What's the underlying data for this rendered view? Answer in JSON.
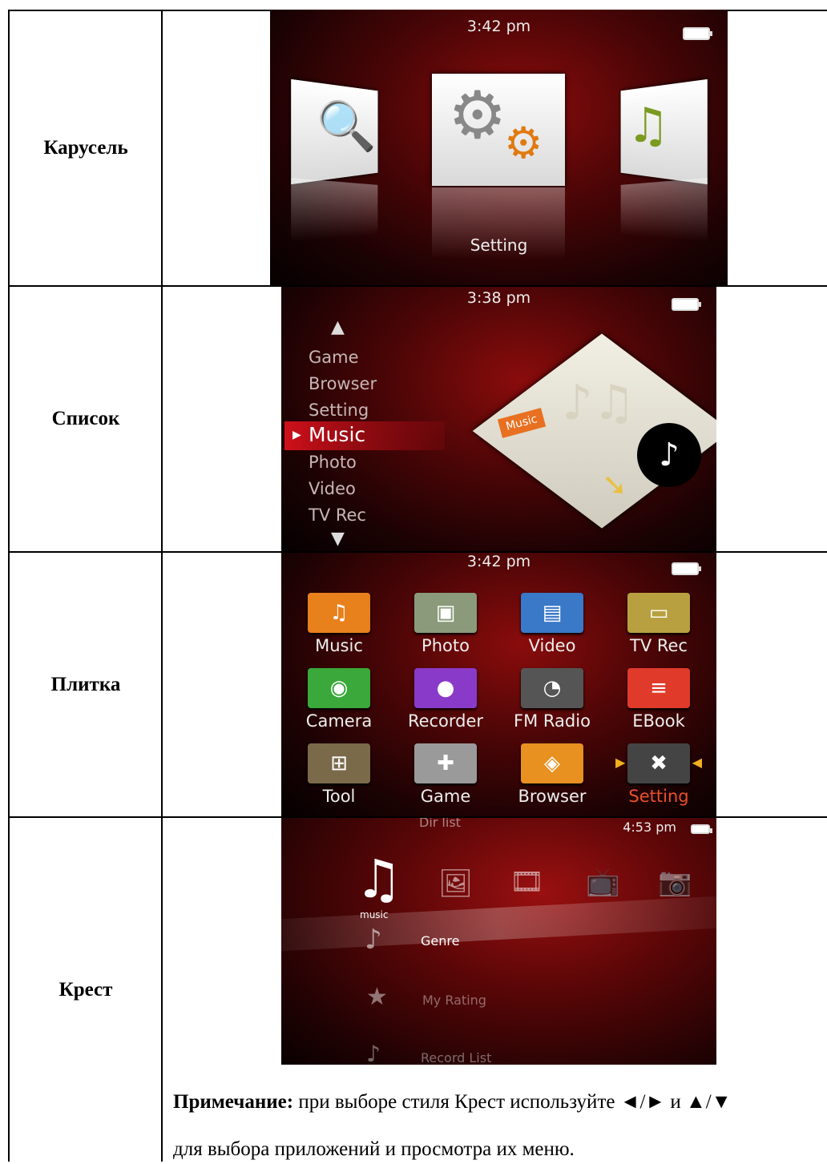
{
  "rows": [
    {
      "label": "Карусель"
    },
    {
      "label": "Список"
    },
    {
      "label": "Плитка"
    },
    {
      "label": "Крест"
    }
  ],
  "carousel": {
    "time": "3:42 pm",
    "caption": "Setting"
  },
  "list": {
    "time": "3:38 pm",
    "items": [
      "Game",
      "Browser",
      "Setting",
      "Music",
      "Photo",
      "Video",
      "TV Rec"
    ],
    "selected": "Music",
    "badge": "Music"
  },
  "tiles": {
    "time": "3:42 pm",
    "items": [
      {
        "label": "Music",
        "color": "#e8801c",
        "icon": "music-note-icon"
      },
      {
        "label": "Photo",
        "color": "#8a9a7a",
        "icon": "photo-icon"
      },
      {
        "label": "Video",
        "color": "#3a78c8",
        "icon": "film-icon"
      },
      {
        "label": "TV Rec",
        "color": "#b8a040",
        "icon": "tv-icon"
      },
      {
        "label": "Camera",
        "color": "#3aa83a",
        "icon": "camera-icon"
      },
      {
        "label": "Recorder",
        "color": "#8a3ac8",
        "icon": "microphone-icon"
      },
      {
        "label": "FM Radio",
        "color": "#555555",
        "icon": "radio-icon"
      },
      {
        "label": "EBook",
        "color": "#e03a2a",
        "icon": "ebook-icon"
      },
      {
        "label": "Tool",
        "color": "#7a6a4a",
        "icon": "calculator-icon"
      },
      {
        "label": "Game",
        "color": "#9a9a9a",
        "icon": "gamepad-icon"
      },
      {
        "label": "Browser",
        "color": "#e89020",
        "icon": "browser-icon"
      },
      {
        "label": "Setting",
        "color": "#444444",
        "icon": "tools-icon",
        "selected": true
      }
    ],
    "selected_color": "#e8502a"
  },
  "cross": {
    "time": "4:53 pm",
    "top_item": "Dir list",
    "category": "music",
    "items": [
      "Genre",
      "My Rating",
      "Record List"
    ]
  },
  "note": {
    "bold": "Примечание:",
    "text": " при выборе стиля Крест используйте ◄/► и ▲/▼",
    "line2": "для выбора приложений и просмотра их меню."
  }
}
